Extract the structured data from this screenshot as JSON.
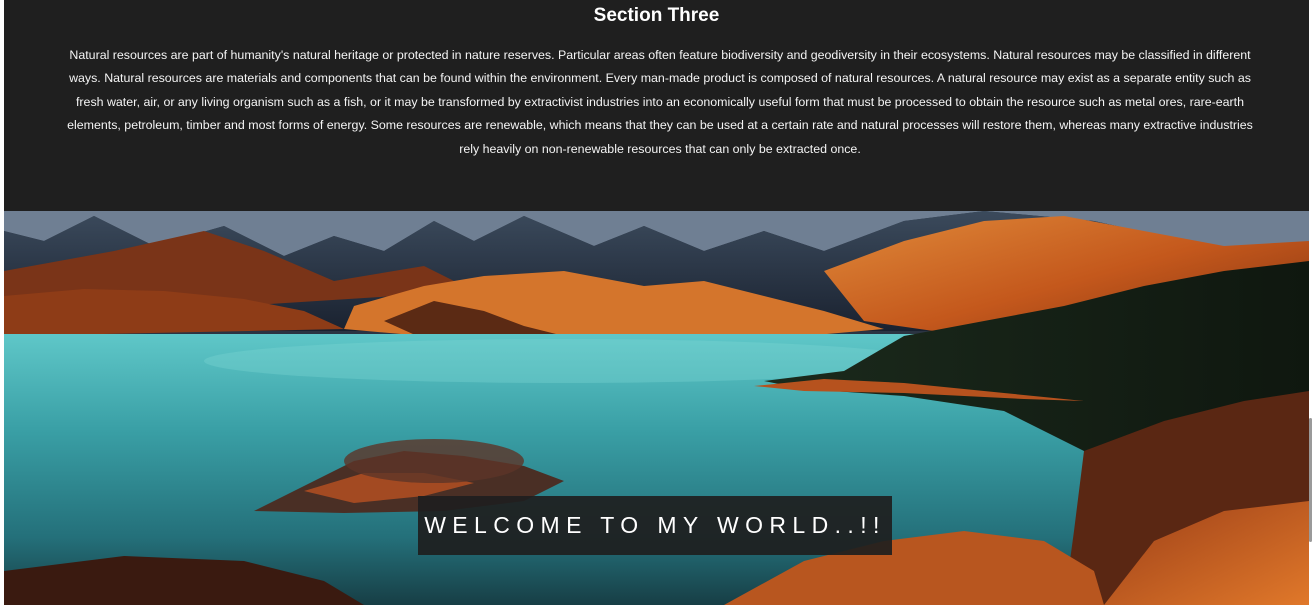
{
  "section": {
    "title": "Section Three",
    "body": "Natural resources are part of humanity's natural heritage or protected in nature reserves. Particular areas often feature biodiversity and geodiversity in their ecosystems. Natural resources may be classified in different ways. Natural resources are materials and components that can be found within the environment. Every man-made product is composed of natural resources. A natural resource may exist as a separate entity such as fresh water, air, or any living organism such as a fish, or it may be transformed by extractivist industries into an economically useful form that must be processed to obtain the resource such as metal ores, rare-earth elements, petroleum, timber and most forms of energy. Some resources are renewable, which means that they can be used at a certain rate and natural processes will restore them, whereas many extractive industries rely heavily on non-renewable resources that can only be extracted once."
  },
  "hero": {
    "image_subject": "mountain-lake-landscape",
    "welcome_text": "WELCOME TO MY WORLD..!!"
  },
  "colors": {
    "section_background": "#1f1f1f",
    "lake": "#3aa0a6",
    "hills": "#c4581c",
    "welcome_box": "#1e1e1e"
  }
}
